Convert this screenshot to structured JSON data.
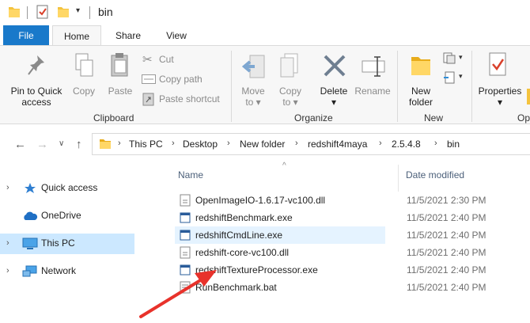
{
  "titlebar": {
    "title": "bin"
  },
  "tabs": {
    "file": "File",
    "home": "Home",
    "share": "Share",
    "view": "View"
  },
  "ribbon": {
    "clipboard": {
      "label": "Clipboard",
      "pin_line1": "Pin to Quick",
      "pin_line2": "access",
      "copy": "Copy",
      "paste": "Paste",
      "cut": "Cut",
      "copy_path": "Copy path",
      "paste_shortcut": "Paste shortcut"
    },
    "organize": {
      "label": "Organize",
      "move_to_line1": "Move",
      "move_to_line2": "to",
      "copy_to_line1": "Copy",
      "copy_to_line2": "to",
      "delete": "Delete",
      "rename": "Rename"
    },
    "new": {
      "label": "New",
      "new_folder_line1": "New",
      "new_folder_line2": "folder"
    },
    "open": {
      "label": "Op",
      "properties": "Properties"
    }
  },
  "address": {
    "crumbs": [
      "This PC",
      "Desktop",
      "New folder",
      "redshift4maya",
      "2.5.4.8",
      "bin"
    ]
  },
  "nav": {
    "items": [
      {
        "label": "Quick access",
        "icon": "star-icon"
      },
      {
        "label": "OneDrive",
        "icon": "cloud-icon"
      },
      {
        "label": "This PC",
        "icon": "computer-icon"
      },
      {
        "label": "Network",
        "icon": "network-icon"
      }
    ]
  },
  "list": {
    "columns": {
      "name": "Name",
      "date": "Date modified"
    },
    "files": [
      {
        "name": "OpenImageIO-1.6.17-vc100.dll",
        "date": "11/5/2021 2:30 PM",
        "type": "dll"
      },
      {
        "name": "redshiftBenchmark.exe",
        "date": "11/5/2021 2:40 PM",
        "type": "exe"
      },
      {
        "name": "redshiftCmdLine.exe",
        "date": "11/5/2021 2:40 PM",
        "type": "exe"
      },
      {
        "name": "redshift-core-vc100.dll",
        "date": "11/5/2021 2:40 PM",
        "type": "dll"
      },
      {
        "name": "redshiftTextureProcessor.exe",
        "date": "11/5/2021 2:40 PM",
        "type": "exe"
      },
      {
        "name": "RunBenchmark.bat",
        "date": "11/5/2021 2:40 PM",
        "type": "bat"
      }
    ]
  },
  "colors": {
    "accent": "#1979ca",
    "selection": "#cce8ff",
    "hover": "#e5f3ff",
    "annotation_arrow": "#e8322b"
  }
}
